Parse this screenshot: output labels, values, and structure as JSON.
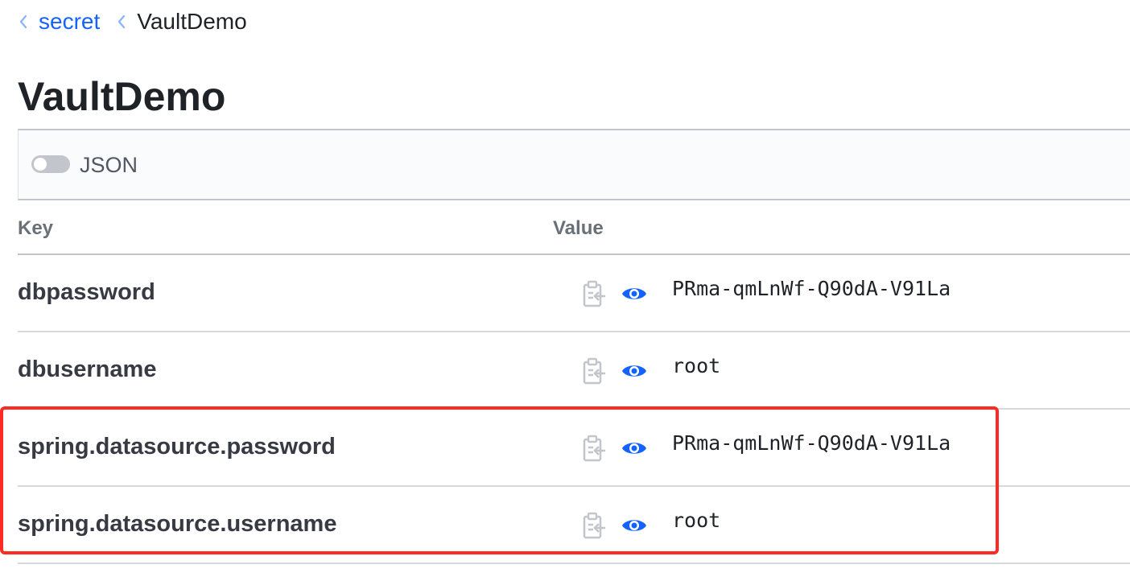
{
  "breadcrumb": {
    "parent": "secret",
    "current": "VaultDemo"
  },
  "page": {
    "title": "VaultDemo"
  },
  "toolbar": {
    "json_toggle_label": "JSON",
    "json_toggle_on": false
  },
  "table": {
    "headers": {
      "key": "Key",
      "value": "Value"
    },
    "rows": [
      {
        "key": "dbpassword",
        "value": "PRma-qmLnWf-Q90dA-V91La"
      },
      {
        "key": "dbusername",
        "value": "root"
      },
      {
        "key": "spring.datasource.password",
        "value": "PRma-qmLnWf-Q90dA-V91La"
      },
      {
        "key": "spring.datasource.username",
        "value": "root"
      }
    ]
  },
  "icons": {
    "copy": "clipboard-copy-icon",
    "reveal": "eye-icon",
    "breadcrumb_separator": "chevron-left-icon"
  },
  "colors": {
    "link": "#1563ff",
    "eye": "#1563ff",
    "highlight": "#ff2a22",
    "copy_icon": "#c2c5cb"
  }
}
